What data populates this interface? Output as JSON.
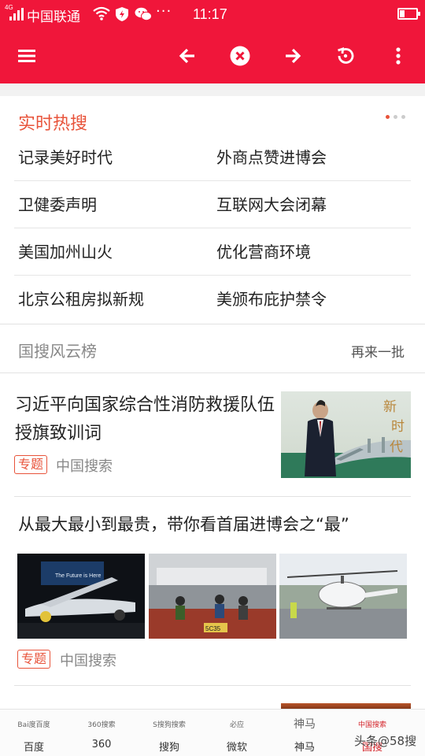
{
  "status_bar": {
    "network_tag": "4G",
    "carrier": "中国联通",
    "time": "11:17",
    "icons": [
      "signal-icon",
      "wifi-icon",
      "shield-icon",
      "wechat-icon",
      "more-dots-icon",
      "battery-icon"
    ],
    "more": "···"
  },
  "toolbar": {
    "icons": [
      "menu-icon",
      "back-arrow-icon",
      "stop-close-icon",
      "forward-arrow-icon",
      "refresh-icon",
      "more-vertical-icon"
    ],
    "accent_color": "#f0163a"
  },
  "hot_search": {
    "title": "实时热搜",
    "title_color": "#e8533a",
    "page_dots": 3,
    "active_dot": 0,
    "items": [
      "记录美好时代",
      "外商点赞进博会",
      "卫健委声明",
      "互联网大会闭幕",
      "美国加州山火",
      "优化营商环境",
      "北京公租房拟新规",
      "美颁布庇护禁令"
    ]
  },
  "ranking": {
    "title": "国搜风云榜",
    "refresh": "再来一批"
  },
  "articles": [
    {
      "title": "习近平向国家综合性消防救援队伍授旗致训词",
      "tag": "专题",
      "source": "中国搜索",
      "image_text": "新时代"
    },
    {
      "title": "从最大最小到最贵，带你看首届进博会之“最”",
      "tag": "专题",
      "source": "中国搜索",
      "image_texts": [
        "The Future is Here",
        "5C35"
      ]
    }
  ],
  "bottom_bar": {
    "items": [
      {
        "label": "百度",
        "logo": "Bai度百度"
      },
      {
        "label": "360",
        "logo": "360搜索"
      },
      {
        "label": "搜狗",
        "logo": "S搜狗搜索"
      },
      {
        "label": "微软",
        "logo": "必应"
      },
      {
        "label": "神马",
        "logo": "神马"
      },
      {
        "label": "国搜",
        "logo": "中国搜索"
      }
    ]
  },
  "watermark": "头条@58搜"
}
